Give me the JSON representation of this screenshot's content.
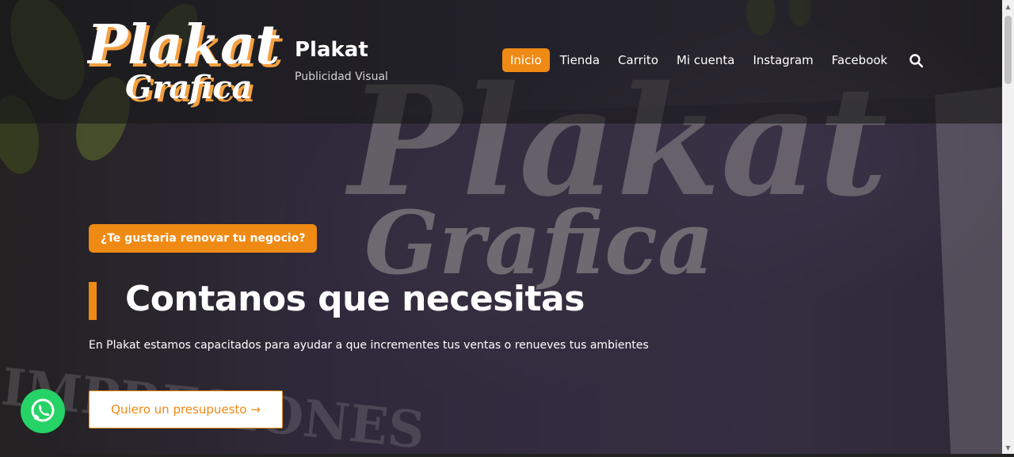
{
  "header": {
    "logo_alt": "Plakat Grafica",
    "site_title": "Plakat",
    "tagline": "Publicidad Visual",
    "nav": [
      {
        "label": "Inicio",
        "active": true
      },
      {
        "label": "Tienda",
        "active": false
      },
      {
        "label": "Carrito",
        "active": false
      },
      {
        "label": "Mi cuenta",
        "active": false
      },
      {
        "label": "Instagram",
        "active": false
      },
      {
        "label": "Facebook",
        "active": false
      }
    ],
    "search_icon": "search-icon"
  },
  "hero": {
    "badge": "¿Te gustaria renovar tu negocio?",
    "heading": "Contanos que necesitas",
    "subtext": "En Plakat estamos capacitados para ayudar a que incrementes tus ventas o renueves tus ambientes",
    "cta": "Quiero un presupuesto →"
  },
  "floating": {
    "whatsapp_icon": "whatsapp-icon"
  },
  "colors": {
    "accent": "#ef8a14",
    "whatsapp": "#25d366",
    "white": "#ffffff"
  }
}
